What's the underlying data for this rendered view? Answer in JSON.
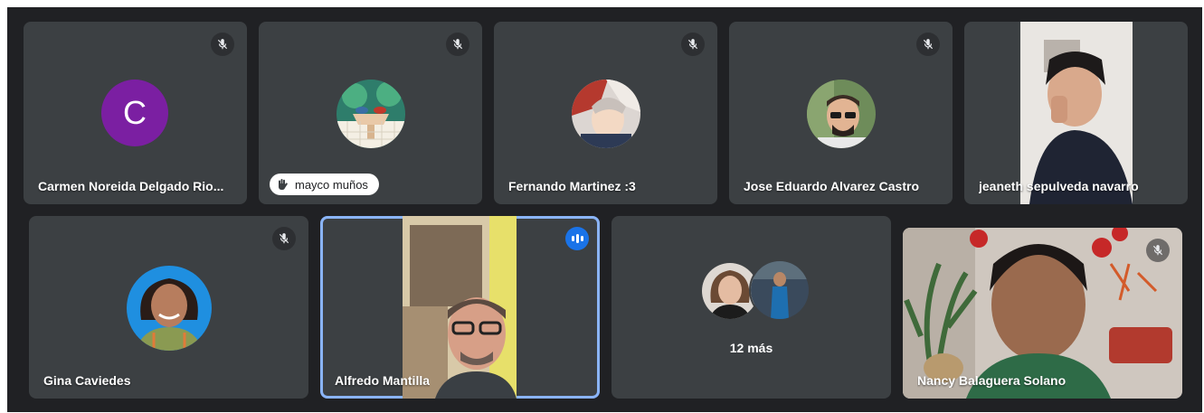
{
  "participants": [
    {
      "name": "Carmen Noreida Delgado Rio...",
      "initial": "C",
      "muted": true
    },
    {
      "name": "mayco muños",
      "muted": true
    },
    {
      "name": "Fernando Martinez :3",
      "muted": true
    },
    {
      "name": "Jose Eduardo Alvarez Castro",
      "muted": true
    },
    {
      "name": "jeaneth sepulveda navarro",
      "muted": false
    },
    {
      "name": "Gina Caviedes",
      "muted": true
    },
    {
      "name": "Alfredo Mantilla",
      "speaking": true
    },
    {
      "name": "Nancy Balaguera Solano",
      "muted": true
    }
  ],
  "overflow": {
    "label": "12 más"
  },
  "colors": {
    "background": "#202124",
    "tile": "#3c4043",
    "accent": "#1a73e8",
    "active_border": "#8ab4f8"
  }
}
